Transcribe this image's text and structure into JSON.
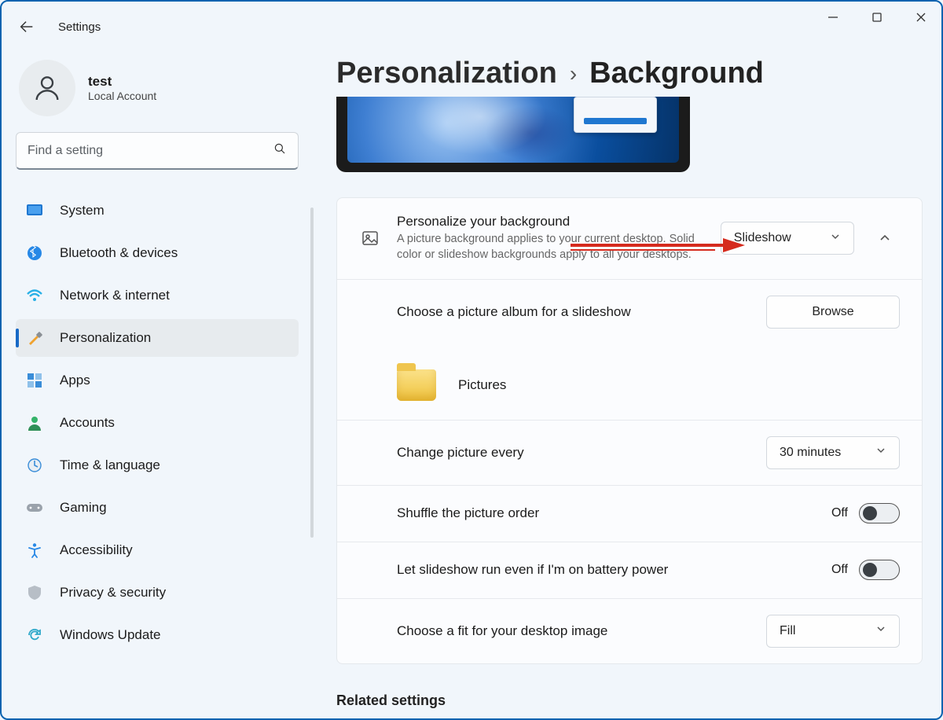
{
  "window": {
    "app_title": "Settings"
  },
  "user": {
    "name": "test",
    "subtitle": "Local Account"
  },
  "search": {
    "placeholder": "Find a setting"
  },
  "sidebar": {
    "items": [
      {
        "label": "System"
      },
      {
        "label": "Bluetooth & devices"
      },
      {
        "label": "Network & internet"
      },
      {
        "label": "Personalization"
      },
      {
        "label": "Apps"
      },
      {
        "label": "Accounts"
      },
      {
        "label": "Time & language"
      },
      {
        "label": "Gaming"
      },
      {
        "label": "Accessibility"
      },
      {
        "label": "Privacy & security"
      },
      {
        "label": "Windows Update"
      }
    ],
    "active_index": 3
  },
  "breadcrumb": {
    "parent": "Personalization",
    "current": "Background"
  },
  "card": {
    "personalize": {
      "title": "Personalize your background",
      "desc": "A picture background applies to your current desktop. Solid color or slideshow backgrounds apply to all your desktops.",
      "dropdown_value": "Slideshow"
    },
    "album": {
      "title": "Choose a picture album for a slideshow",
      "browse_label": "Browse",
      "folder_name": "Pictures"
    },
    "interval": {
      "title": "Change picture every",
      "dropdown_value": "30 minutes"
    },
    "shuffle": {
      "title": "Shuffle the picture order",
      "state_label": "Off"
    },
    "battery": {
      "title": "Let slideshow run even if I'm on battery power",
      "state_label": "Off"
    },
    "fit": {
      "title": "Choose a fit for your desktop image",
      "dropdown_value": "Fill"
    }
  },
  "related": {
    "header": "Related settings"
  },
  "colors": {
    "accent": "#1769c6",
    "annotation": "#d52b1e"
  }
}
